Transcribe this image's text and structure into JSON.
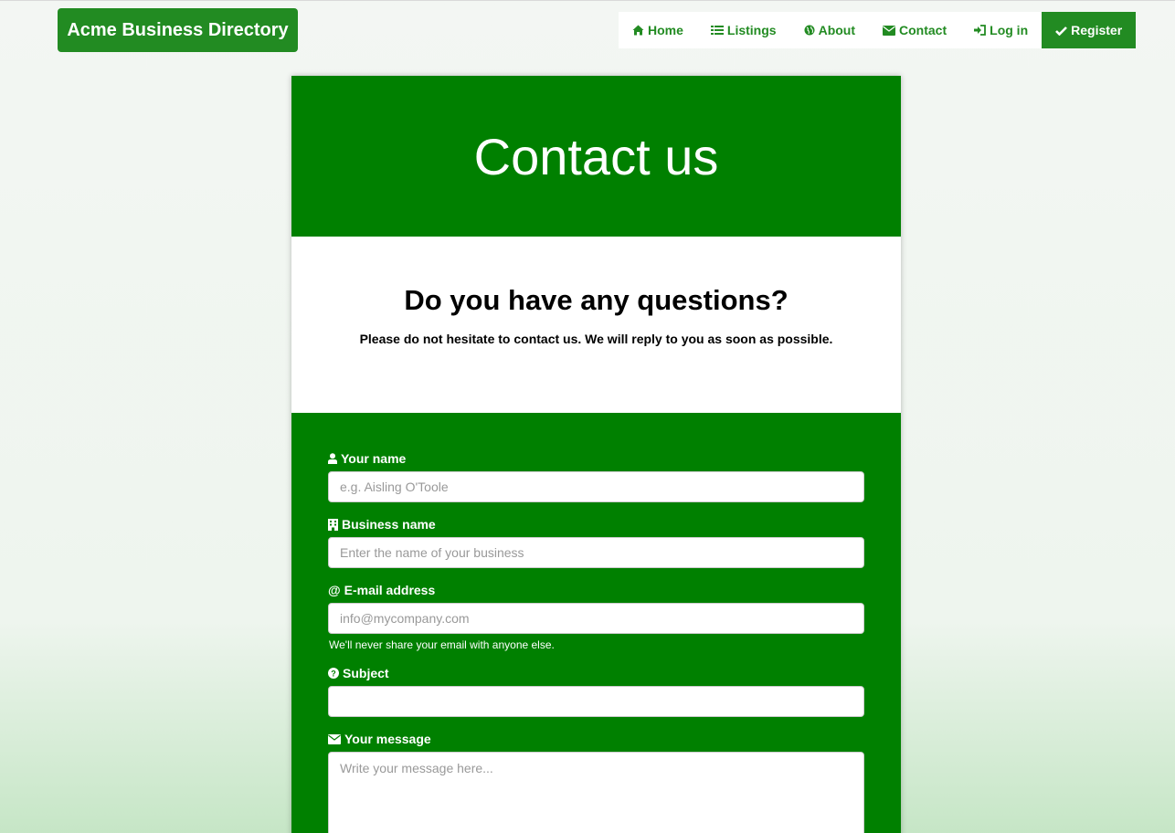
{
  "brand": {
    "title": "Acme Business Directory"
  },
  "nav": {
    "items": [
      {
        "label": "Home",
        "icon": "home-icon"
      },
      {
        "label": "Listings",
        "icon": "list-icon"
      },
      {
        "label": "About",
        "icon": "globe-icon"
      },
      {
        "label": "Contact",
        "icon": "envelope-icon"
      },
      {
        "label": "Log in",
        "icon": "sign-in-icon"
      },
      {
        "label": "Register",
        "icon": "check-icon"
      }
    ]
  },
  "hero": {
    "title": "Contact us"
  },
  "intro": {
    "heading": "Do you have any questions?",
    "text": "Please do not hesitate to contact us. We will reply to you as soon as possible."
  },
  "form": {
    "name": {
      "label": "Your name",
      "placeholder": "e.g. Aisling O'Toole",
      "icon": "user-icon"
    },
    "business": {
      "label": "Business name",
      "placeholder": "Enter the name of your business",
      "icon": "building-icon"
    },
    "email": {
      "label": "E-mail address",
      "placeholder": "info@mycompany.com",
      "help": "We'll never share your email with anyone else.",
      "icon": "at-icon"
    },
    "subject": {
      "label": "Subject",
      "placeholder": "",
      "icon": "question-circle-icon"
    },
    "message": {
      "label": "Your message",
      "placeholder": "Write your message here...",
      "icon": "envelope-icon"
    }
  },
  "colors": {
    "brand_green": "#228b22",
    "hero_green": "#008000"
  }
}
